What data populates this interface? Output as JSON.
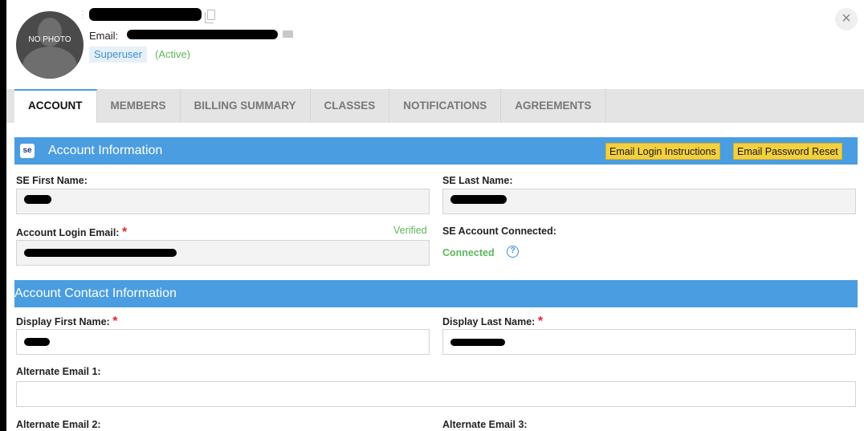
{
  "header": {
    "avatar_text": "NO PHOTO",
    "email_label": "Email:",
    "role_badge": "Superuser",
    "status": "(Active)"
  },
  "tabs": [
    {
      "label": "ACCOUNT",
      "active": true
    },
    {
      "label": "MEMBERS"
    },
    {
      "label": "BILLING SUMMARY"
    },
    {
      "label": "CLASSES"
    },
    {
      "label": "NOTIFICATIONS"
    },
    {
      "label": "AGREEMENTS"
    }
  ],
  "account_info": {
    "icon_text": "se",
    "title": "Account Information",
    "email_login_button": "Email Login Instructions",
    "email_password_button": "Email Password Reset",
    "se_first_name_label": "SE First Name:",
    "se_last_name_label": "SE Last Name:",
    "login_email_label": "Account Login Email:",
    "verified": "Verified",
    "account_connected_label": "SE Account Connected:",
    "connected": "Connected"
  },
  "contact_info": {
    "title": "Account Contact Information",
    "display_first_name_label": "Display First Name:",
    "display_last_name_label": "Display Last Name:",
    "alt_email_1_label": "Alternate Email 1:",
    "alt_email_2_label": "Alternate Email 2:",
    "alt_email_3_label": "Alternate Email 3:"
  },
  "required_mark": "*",
  "colors": {
    "accent_blue": "#4a9de0",
    "button_yellow": "#f4d03f",
    "success_green": "#5cb85c",
    "required_red": "#e0262a"
  }
}
